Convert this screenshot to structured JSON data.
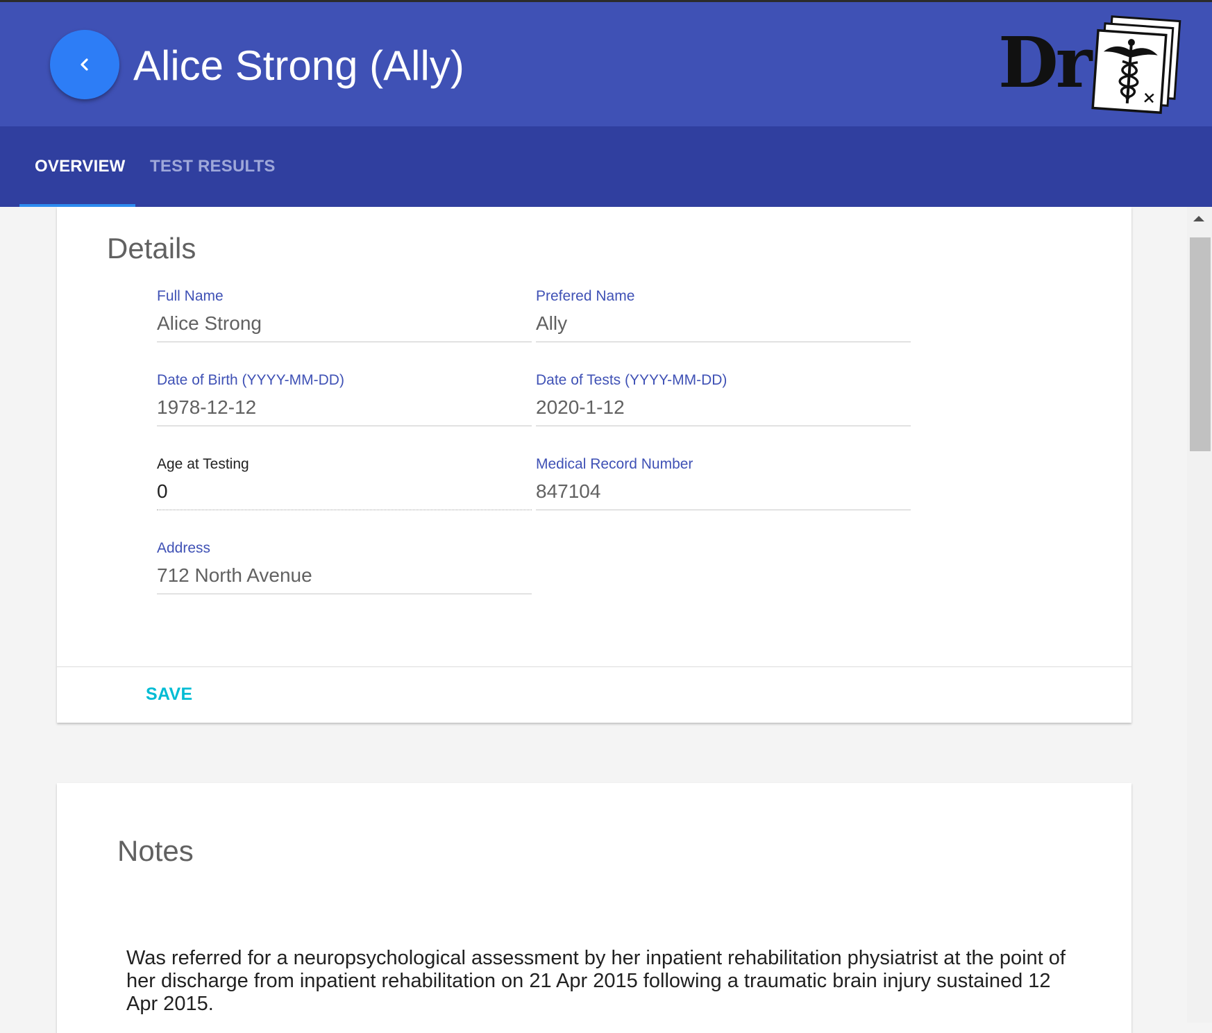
{
  "header": {
    "title": "Alice Strong (Ally)",
    "back_icon": "chevron-left-icon",
    "logo_text": "Dr",
    "logo_icon": "caduceus-icon"
  },
  "tabs": [
    {
      "label": "OVERVIEW",
      "active": true
    },
    {
      "label": "TEST RESULTS",
      "active": false
    }
  ],
  "details": {
    "title": "Details",
    "fields": {
      "full_name": {
        "label": "Full Name",
        "value": "Alice Strong"
      },
      "preferred_name": {
        "label": "Prefered Name",
        "value": "Ally"
      },
      "date_of_birth": {
        "label": "Date of Birth (YYYY-MM-DD)",
        "value": "1978-12-12"
      },
      "date_of_tests": {
        "label": "Date of Tests (YYYY-MM-DD)",
        "value": "2020-1-12"
      },
      "age_at_testing": {
        "label": "Age at Testing",
        "value": "0"
      },
      "medical_record_number": {
        "label": "Medical Record Number",
        "value": "847104"
      },
      "address": {
        "label": "Address",
        "value": "712 North Avenue"
      }
    },
    "save_label": "SAVE"
  },
  "notes": {
    "title": "Notes",
    "text": "Was referred for a neuropsychological assessment by her inpatient rehabilitation physiatrist at the point of her discharge from inpatient rehabilitation on 21 Apr 2015 following a traumatic brain injury sustained 12 Apr 2015."
  },
  "colors": {
    "appbar": "#3f51b5",
    "tabbar": "#303f9f",
    "accent": "#2d7df6",
    "label": "#3f51b5",
    "save": "#00bcd4"
  }
}
